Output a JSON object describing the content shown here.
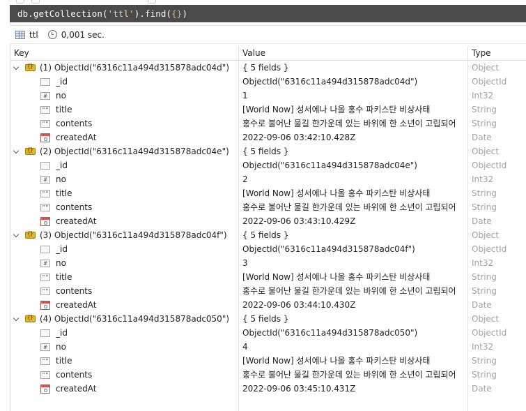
{
  "query": {
    "prefix": "db.getCollection(",
    "collection": "'ttl'",
    "suffix_open": ").find(",
    "braces": "{}",
    "suffix_close": ")"
  },
  "info": {
    "collection_name": "ttl",
    "exec_time": "0,001 sec."
  },
  "columns": {
    "key": "Key",
    "value": "Value",
    "type": "Type"
  },
  "documents": [
    {
      "label": "(1) ObjectId(\"6316c11a494d315878adc04d\")",
      "value": "{ 5 fields }",
      "type": "Object",
      "fields": [
        {
          "key": "_id",
          "icon": "id",
          "value": "ObjectId(\"6316c11a494d315878adc04d\")",
          "type": "ObjectId"
        },
        {
          "key": "no",
          "icon": "num",
          "value": "1",
          "type": "Int32"
        },
        {
          "key": "title",
          "icon": "str",
          "value": "[World Now] 성서에나 나올 홍수 파키스탄 비상사태",
          "type": "String"
        },
        {
          "key": "contents",
          "icon": "str",
          "value": "홍수로 불어난 물길 한가운데 있는 바위에 한 소년이 고립되어",
          "type": "String"
        },
        {
          "key": "createdAt",
          "icon": "date",
          "value": "2022-09-06 03:42:10.428Z",
          "type": "Date"
        }
      ]
    },
    {
      "label": "(2) ObjectId(\"6316c11a494d315878adc04e\")",
      "value": "{ 5 fields }",
      "type": "Object",
      "fields": [
        {
          "key": "_id",
          "icon": "id",
          "value": "ObjectId(\"6316c11a494d315878adc04e\")",
          "type": "ObjectId"
        },
        {
          "key": "no",
          "icon": "num",
          "value": "2",
          "type": "Int32"
        },
        {
          "key": "title",
          "icon": "str",
          "value": "[World Now] 성서에나 나올 홍수 파키스탄 비상사태",
          "type": "String"
        },
        {
          "key": "contents",
          "icon": "str",
          "value": "홍수로 불어난 물길 한가운데 있는 바위에 한 소년이 고립되어",
          "type": "String"
        },
        {
          "key": "createdAt",
          "icon": "date",
          "value": "2022-09-06 03:43:10.429Z",
          "type": "Date"
        }
      ]
    },
    {
      "label": "(3) ObjectId(\"6316c11a494d315878adc04f\")",
      "value": "{ 5 fields }",
      "type": "Object",
      "fields": [
        {
          "key": "_id",
          "icon": "id",
          "value": "ObjectId(\"6316c11a494d315878adc04f\")",
          "type": "ObjectId"
        },
        {
          "key": "no",
          "icon": "num",
          "value": "3",
          "type": "Int32"
        },
        {
          "key": "title",
          "icon": "str",
          "value": "[World Now] 성서에나 나올 홍수 파키스탄 비상사태",
          "type": "String"
        },
        {
          "key": "contents",
          "icon": "str",
          "value": "홍수로 불어난 물길 한가운데 있는 바위에 한 소년이 고립되어",
          "type": "String"
        },
        {
          "key": "createdAt",
          "icon": "date",
          "value": "2022-09-06 03:44:10.430Z",
          "type": "Date"
        }
      ]
    },
    {
      "label": "(4) ObjectId(\"6316c11a494d315878adc050\")",
      "value": "{ 5 fields }",
      "type": "Object",
      "fields": [
        {
          "key": "_id",
          "icon": "id",
          "value": "ObjectId(\"6316c11a494d315878adc050\")",
          "type": "ObjectId"
        },
        {
          "key": "no",
          "icon": "num",
          "value": "4",
          "type": "Int32"
        },
        {
          "key": "title",
          "icon": "str",
          "value": "[World Now] 성서에나 나올 홍수 파키스탄 비상사태",
          "type": "String"
        },
        {
          "key": "contents",
          "icon": "str",
          "value": "홍수로 불어난 물길 한가운데 있는 바위에 한 소년이 고립되어",
          "type": "String"
        },
        {
          "key": "createdAt",
          "icon": "date",
          "value": "2022-09-06 03:45:10.431Z",
          "type": "Date"
        }
      ]
    }
  ],
  "icons": {
    "id": "",
    "num": "#",
    "str": "\"\""
  }
}
